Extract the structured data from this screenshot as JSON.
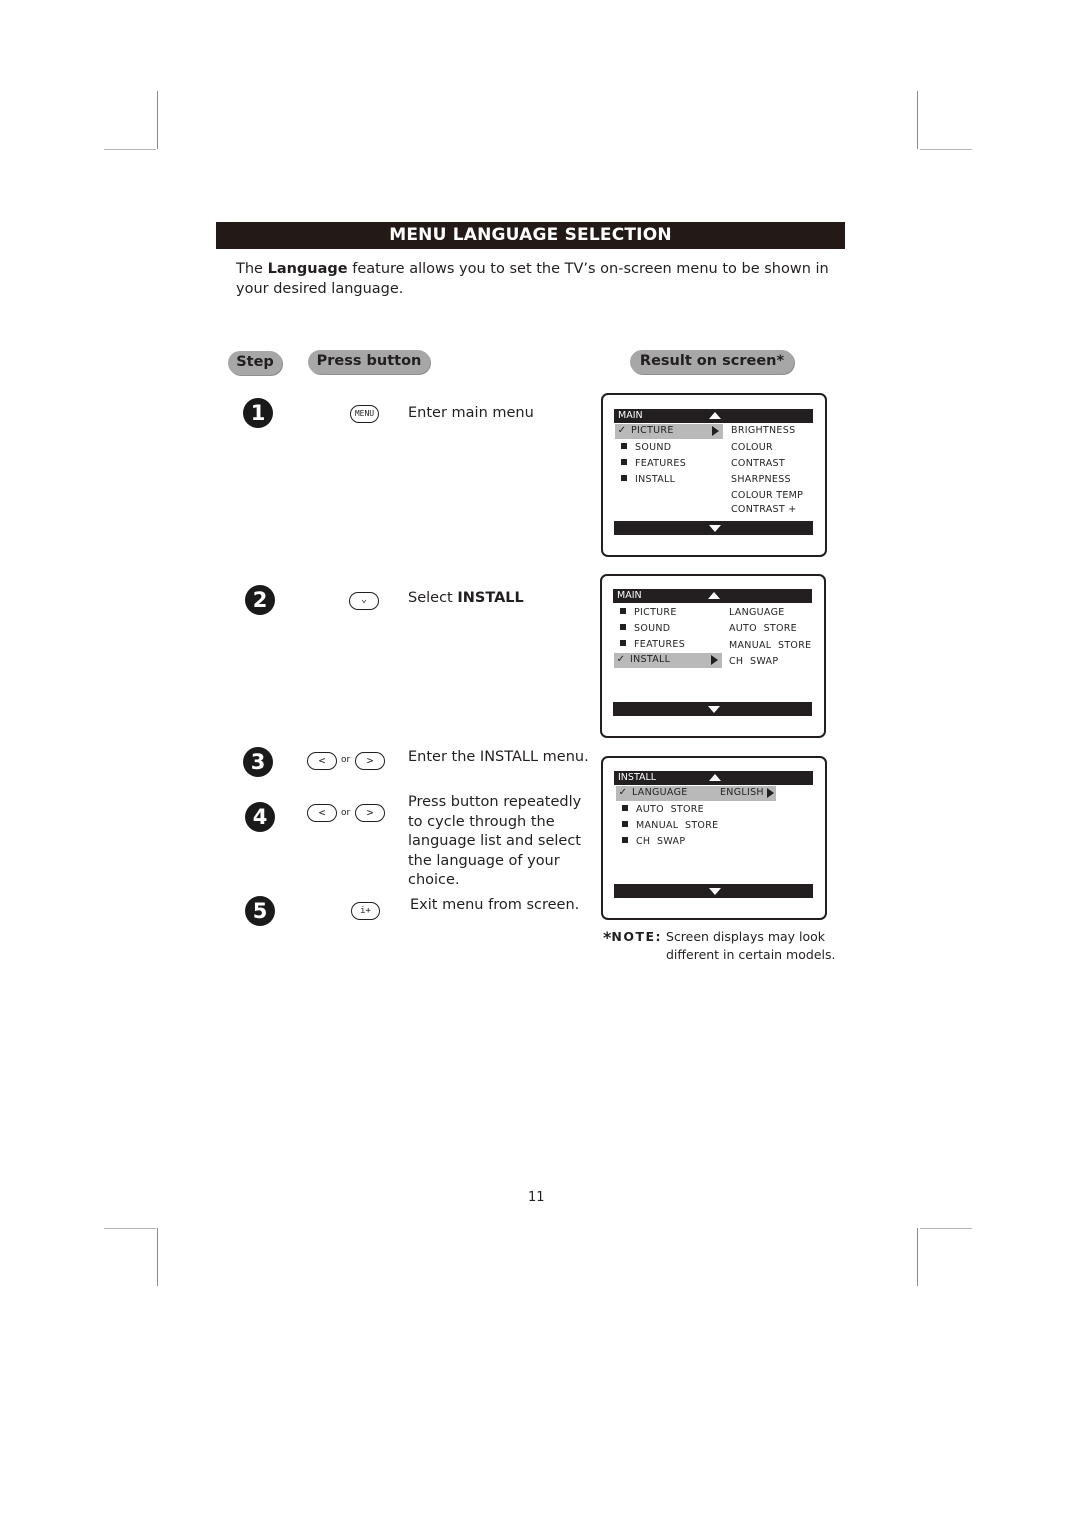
{
  "header": {
    "title": "MENU LANGUAGE SELECTION",
    "intro_prefix": "The ",
    "intro_bold": "Language",
    "intro_suffix": " feature allows you to set the TV’s on-screen menu to be shown in your desired language."
  },
  "columns": {
    "step": "Step",
    "press_button": "Press button",
    "result": "Result on screen*"
  },
  "steps": [
    {
      "number": "1",
      "button_icon": "menu-button",
      "button_label": "MENU",
      "text": "Enter main menu"
    },
    {
      "number": "2",
      "button_icon": "down-button",
      "button_label": "⌵",
      "text_prefix": "Select ",
      "text_bold": "INSTALL"
    },
    {
      "number": "3",
      "button_icon": "left-or-right-button",
      "left_label": "<",
      "or_label": "or",
      "right_label": ">",
      "text": "Enter the INSTALL menu."
    },
    {
      "number": "4",
      "button_icon": "left-or-right-button",
      "left_label": "<",
      "or_label": "or",
      "right_label": ">",
      "text": "Press button repeatedly to cycle through the language list and select the language of your choice."
    },
    {
      "number": "5",
      "button_icon": "info-plus-button",
      "button_label": "i+",
      "text": "Exit menu from screen."
    }
  ],
  "screens": [
    {
      "header": "MAIN",
      "left_items": [
        {
          "label": "PICTURE",
          "selected": true
        },
        {
          "label": "SOUND",
          "selected": false
        },
        {
          "label": "FEATURES",
          "selected": false
        },
        {
          "label": "INSTALL",
          "selected": false
        }
      ],
      "right_items": [
        "BRIGHTNESS",
        "COLOUR",
        "CONTRAST",
        "SHARPNESS",
        "COLOUR TEMP",
        "CONTRAST +"
      ]
    },
    {
      "header": "MAIN",
      "left_items": [
        {
          "label": "PICTURE",
          "selected": false
        },
        {
          "label": "SOUND",
          "selected": false
        },
        {
          "label": "FEATURES",
          "selected": false
        },
        {
          "label": "INSTALL",
          "selected": true
        }
      ],
      "right_items": [
        "LANGUAGE",
        "AUTO  STORE",
        "MANUAL  STORE",
        "CH  SWAP"
      ]
    },
    {
      "header": "INSTALL",
      "left_items": [
        {
          "label": "LANGUAGE",
          "selected": true,
          "value": "ENGLISH"
        },
        {
          "label": "AUTO  STORE",
          "selected": false
        },
        {
          "label": "MANUAL  STORE",
          "selected": false
        },
        {
          "label": "CH  SWAP",
          "selected": false
        }
      ],
      "right_items": []
    }
  ],
  "note": {
    "star": "*",
    "label": "NOTE:",
    "line1": " Screen displays may look",
    "line2": "different in certain models."
  },
  "page_number": "11"
}
